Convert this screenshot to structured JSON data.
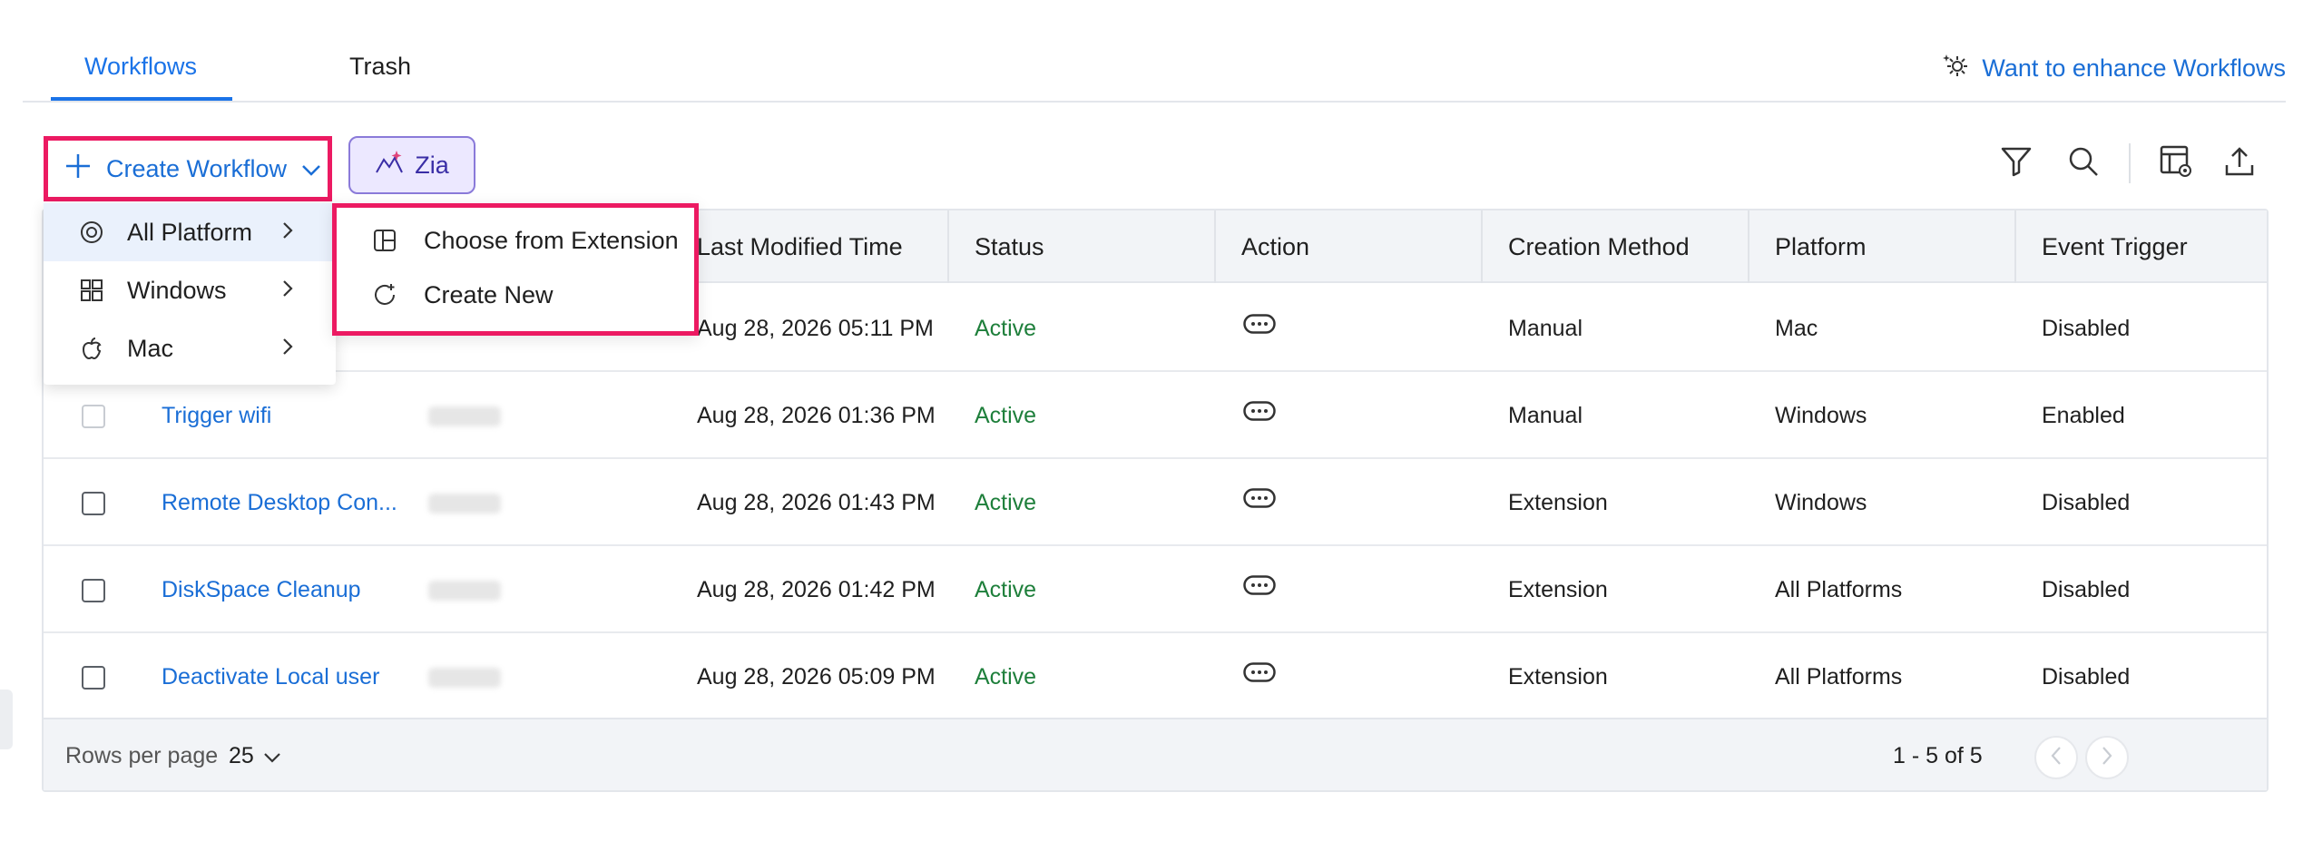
{
  "tabs": [
    {
      "label": "Workflows",
      "active": true
    },
    {
      "label": "Trash",
      "active": false
    }
  ],
  "enhance_link": "Want to enhance Workflows",
  "toolbar": {
    "create_label": "Create Workflow",
    "zia_label": "Zia"
  },
  "table": {
    "columns": [
      "Last Modified Time",
      "Status",
      "Action",
      "Creation Method",
      "Platform",
      "Event Trigger"
    ],
    "rows": [
      {
        "name": "",
        "modified": "Aug 28, 2026 05:11 PM",
        "status": "Active",
        "creation": "Manual",
        "platform": "Mac",
        "trigger": "Disabled"
      },
      {
        "name": "Trigger wifi",
        "modified": "Aug 28, 2026 01:36 PM",
        "status": "Active",
        "creation": "Manual",
        "platform": "Windows",
        "trigger": "Enabled"
      },
      {
        "name": "Remote Desktop Con...",
        "modified": "Aug 28, 2026 01:43 PM",
        "status": "Active",
        "creation": "Extension",
        "platform": "Windows",
        "trigger": "Disabled"
      },
      {
        "name": "DiskSpace Cleanup",
        "modified": "Aug 28, 2026 01:42 PM",
        "status": "Active",
        "creation": "Extension",
        "platform": "All Platforms",
        "trigger": "Disabled"
      },
      {
        "name": "Deactivate Local user",
        "modified": "Aug 28, 2026 05:09 PM",
        "status": "Active",
        "creation": "Extension",
        "platform": "All Platforms",
        "trigger": "Disabled"
      }
    ]
  },
  "footer": {
    "rows_per_page_label": "Rows per page",
    "rows_per_page_value": "25",
    "range": "1 - 5 of 5"
  },
  "platform_menu": [
    {
      "label": "All Platform",
      "icon": "all-platform-icon",
      "selected": true
    },
    {
      "label": "Windows",
      "icon": "windows-icon",
      "selected": false
    },
    {
      "label": "Mac",
      "icon": "apple-icon",
      "selected": false
    }
  ],
  "create_menu": [
    {
      "label": "Choose from Extension",
      "icon": "extension-icon"
    },
    {
      "label": "Create New",
      "icon": "create-new-icon"
    }
  ],
  "colors": {
    "accent": "#1a73e8",
    "highlight_border": "#ec1a62",
    "status_active": "#1e7f3b"
  }
}
